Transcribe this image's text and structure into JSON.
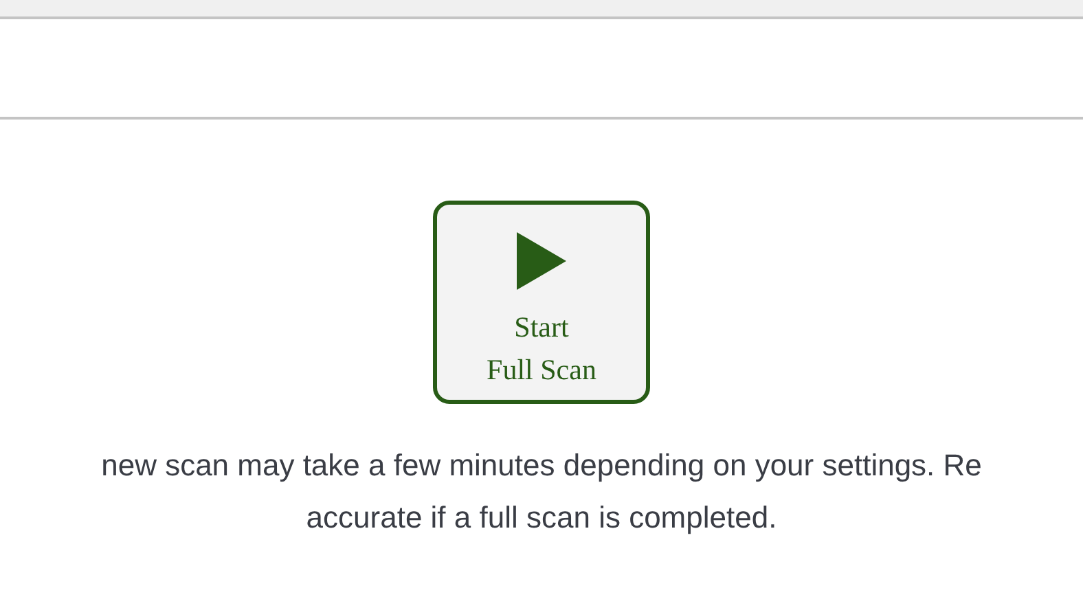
{
  "scan_button": {
    "label_lines": [
      "Start",
      "Full Scan"
    ]
  },
  "description": [
    "new scan may take a few minutes depending on your settings. Re",
    "accurate if a full scan is completed."
  ]
}
